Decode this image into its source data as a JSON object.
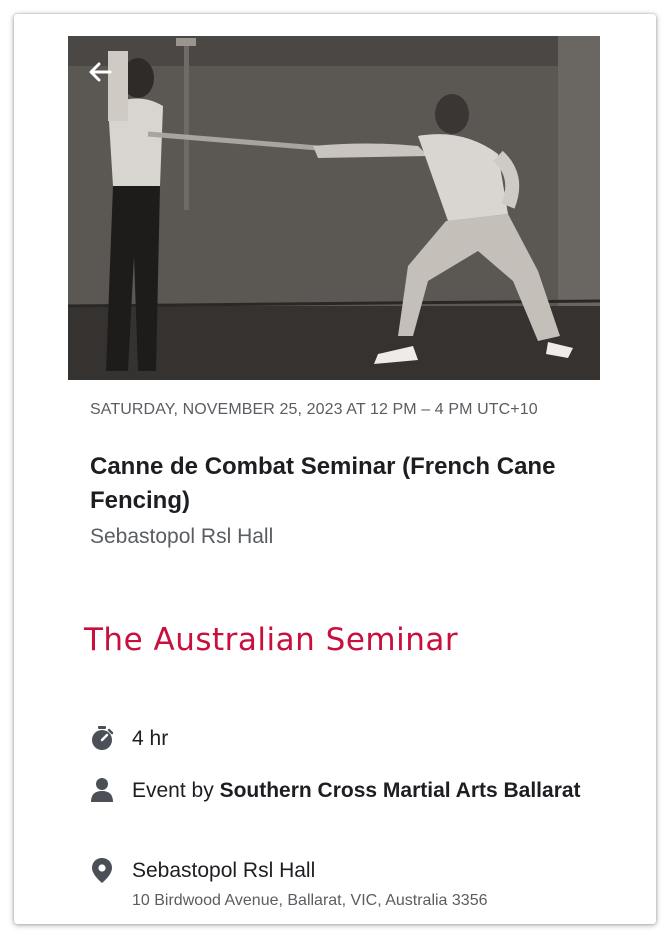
{
  "header": {
    "back_icon": "arrow-left-icon"
  },
  "event": {
    "date_time": "SATURDAY, NOVEMBER 25, 2023 AT 12 PM – 4 PM UTC+10",
    "title": "Canne de Combat Seminar (French Cane Fencing)",
    "venue": "Sebastopol Rsl Hall",
    "banner_heading": "The Australian Seminar"
  },
  "details": {
    "duration": {
      "icon": "stopwatch-icon",
      "text": "4 hr"
    },
    "host": {
      "icon": "person-icon",
      "prefix": "Event by ",
      "name": "Southern Cross Martial Arts Ballarat"
    },
    "location": {
      "icon": "map-pin-icon",
      "name": "Sebastopol Rsl Hall",
      "address": "10 Birdwood Avenue, Ballarat, VIC, Australia 3356"
    }
  },
  "colors": {
    "heading_accent": "#c8103e",
    "primary_text": "#1c1e21",
    "secondary_text": "#5a5d61"
  }
}
